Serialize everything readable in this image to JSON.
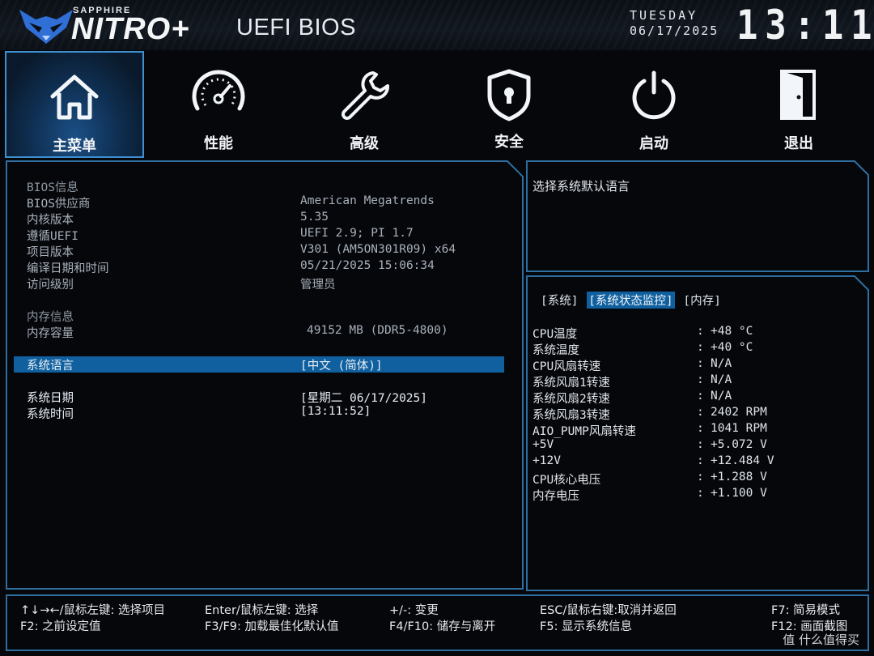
{
  "header": {
    "brand_small": "SAPPHIRE",
    "brand_big": "NITRO+",
    "title": "UEFI BIOS",
    "day": "TUESDAY",
    "date": "06/17/2025",
    "time": "13:11"
  },
  "nav": [
    {
      "label": "主菜单",
      "icon": "home-icon",
      "active": true
    },
    {
      "label": "性能",
      "icon": "speedometer-icon",
      "active": false
    },
    {
      "label": "高级",
      "icon": "wrench-icon",
      "active": false
    },
    {
      "label": "安全",
      "icon": "shield-lock-icon",
      "active": false
    },
    {
      "label": "启动",
      "icon": "power-icon",
      "active": false
    },
    {
      "label": "退出",
      "icon": "exit-door-icon",
      "active": false
    }
  ],
  "main": {
    "bios_info_heading": "BIOS信息",
    "rows": [
      {
        "label": "BIOS供应商",
        "value": "American Megatrends"
      },
      {
        "label": "内核版本",
        "value": "5.35"
      },
      {
        "label": "遵循UEFI",
        "value": "UEFI 2.9; PI 1.7"
      },
      {
        "label": "项目版本",
        "value": "V301 (AM5ON301R09) x64"
      },
      {
        "label": "编译日期和时间",
        "value": "05/21/2025 15:06:34"
      },
      {
        "label": "访问级别",
        "value": "管理员"
      }
    ],
    "memory_heading": "内存信息",
    "memory_label": "内存容量",
    "memory_value": "49152 MB (DDR5-4800)",
    "language_label": "系统语言",
    "language_value": "[中文 (简体)]",
    "date_label": "系统日期",
    "date_value": "[星期二 06/17/2025]",
    "time_label": "系统时间",
    "time_value": "[13:11:52]"
  },
  "help": {
    "text": "选择系统默认语言"
  },
  "hardware": {
    "tabs": [
      "[系统]",
      "[系统状态监控]",
      "[内存]"
    ],
    "active_tab": 1,
    "rows": [
      {
        "label": "CPU温度",
        "value": "+48 °C"
      },
      {
        "label": "系统温度",
        "value": "+40 °C"
      },
      {
        "label": "CPU风扇转速",
        "value": "N/A"
      },
      {
        "label": "系统风扇1转速",
        "value": "N/A"
      },
      {
        "label": "系统风扇2转速",
        "value": "N/A"
      },
      {
        "label": "系统风扇3转速",
        "value": "2402 RPM"
      },
      {
        "label": "AIO_PUMP风扇转速",
        "value": "1041 RPM"
      },
      {
        "label": "+5V",
        "value": "+5.072 V"
      },
      {
        "label": "+12V",
        "value": "+12.484 V"
      },
      {
        "label": "CPU核心电压",
        "value": "+1.288 V"
      },
      {
        "label": "内存电压",
        "value": "+1.100 V"
      }
    ]
  },
  "footer": {
    "col1": [
      "↑↓→←/鼠标左键: 选择项目",
      "F2: 之前设定值"
    ],
    "col2": [
      "Enter/鼠标左键: 选择",
      "F3/F9: 加载最佳化默认值"
    ],
    "col3": [
      "+/-: 变更",
      "F4/F10: 储存与离开"
    ],
    "col4": [
      "ESC/鼠标右键:取消并返回",
      "F5: 显示系统信息"
    ],
    "col5": [
      "F7: 简易模式",
      "F12: 画面截图"
    ]
  },
  "watermark": "值 什么值得买",
  "colors": {
    "accent": "#10609f",
    "border": "#2f6fa0",
    "background": "#05070b"
  }
}
